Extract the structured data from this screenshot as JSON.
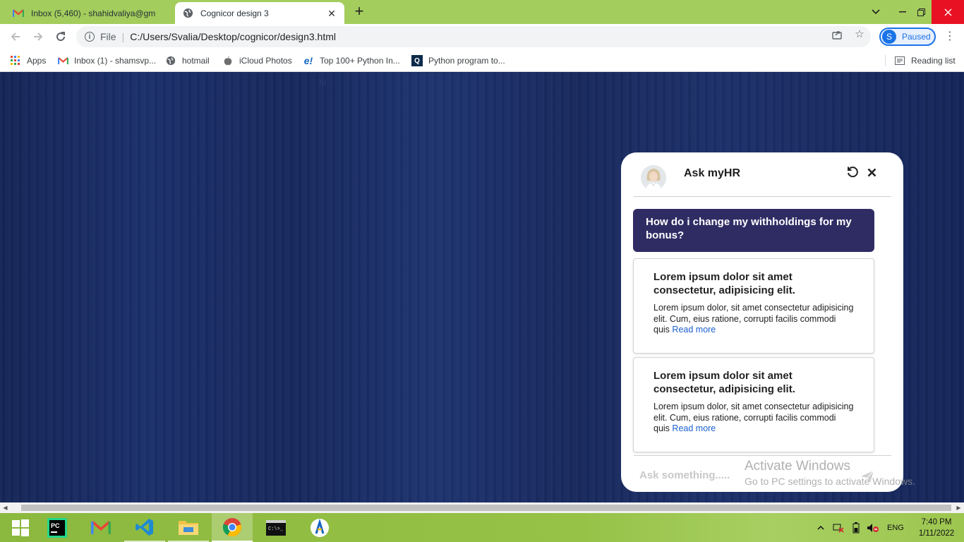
{
  "browser": {
    "tabs": [
      {
        "title": "Inbox (5,460) - shahidvaliya@gm",
        "active": false
      },
      {
        "title": "Cognicor design 3",
        "active": true
      }
    ],
    "address": {
      "scheme_label": "File",
      "url": "C:/Users/Svalia/Desktop/cognicor/design3.html"
    },
    "profile": {
      "initial": "S",
      "status": "Paused"
    },
    "bookmarks": [
      {
        "label": "Apps",
        "icon": "apps-grid-icon"
      },
      {
        "label": "Inbox (1) - shamsvp...",
        "icon": "gmail-icon"
      },
      {
        "label": "hotmail",
        "icon": "globe-icon"
      },
      {
        "label": "iCloud Photos",
        "icon": "apple-icon"
      },
      {
        "label": "Top 100+ Python In...",
        "icon": "edureka-icon"
      },
      {
        "label": "Python program to...",
        "icon": "bracket-q-icon"
      }
    ],
    "reading_list": "Reading list"
  },
  "page": {
    "hi_text": "hi"
  },
  "chat": {
    "title": "Ask myHR",
    "user_message": "How do i change my withholdings for my bonus?",
    "cards": [
      {
        "title": "Lorem ipsum dolor sit amet consectetur, adipisicing elit.",
        "body": "Lorem ipsum dolor, sit amet consectetur adipisicing elit. Cum, eius ratione, corrupti facilis commodi quis",
        "link": "Read more"
      },
      {
        "title": "Lorem ipsum dolor sit amet consectetur, adipisicing elit.",
        "body": "Lorem ipsum dolor, sit amet consectetur adipisicing elit. Cum, eius ratione, corrupti facilis commodi quis",
        "link": "Read more"
      }
    ],
    "input_placeholder": "Ask something....."
  },
  "watermark": {
    "title": "Activate Windows",
    "subtitle": "Go to PC settings to activate Windows."
  },
  "taskbar": {
    "language": "ENG",
    "time": "7:40 PM",
    "date": "1/11/2022"
  },
  "colors": {
    "tabstrip": "#a3cd5c",
    "chat_bubble": "#2f2c64",
    "link": "#1a5fd0",
    "page_bg": "#1a2a5e"
  }
}
